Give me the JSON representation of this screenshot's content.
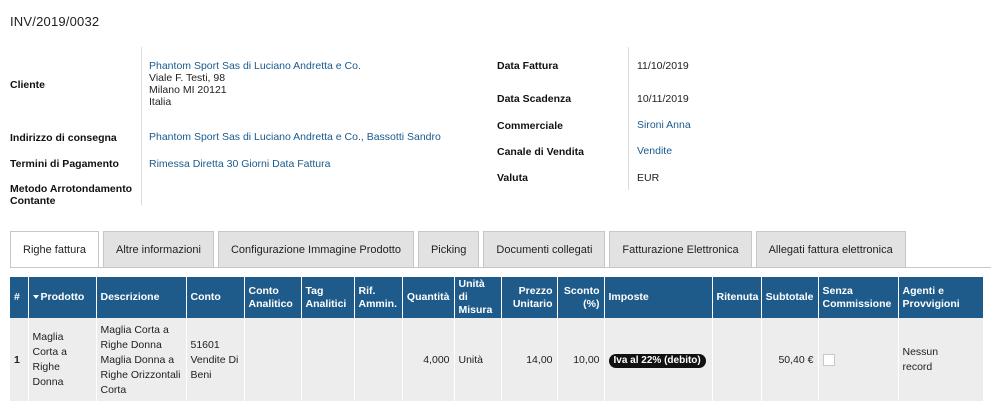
{
  "document": {
    "title": "INV/2019/0032"
  },
  "left_fields": {
    "cliente_label": "Cliente",
    "cliente_name": "Phantom Sport Sas di Luciano Andretta e Co.",
    "cliente_addr1": "Viale F. Testi, 98",
    "cliente_addr2": "Milano MI 20121",
    "cliente_addr3": "Italia",
    "consegna_label": "Indirizzo di consegna",
    "consegna_value": "Phantom Sport Sas di Luciano Andretta e Co., Bassotti Sandro",
    "pagamento_label": "Termini di Pagamento",
    "pagamento_value": "Rimessa Diretta 30 Giorni Data Fattura",
    "arrotondamento_label_1": "Metodo Arrotondamento",
    "arrotondamento_label_2": "Contante"
  },
  "right_fields": {
    "data_fattura_label": "Data Fattura",
    "data_fattura_value": "11/10/2019",
    "data_scadenza_label": "Data Scadenza",
    "data_scadenza_value": "10/11/2019",
    "commerciale_label": "Commerciale",
    "commerciale_value": "Sironi Anna",
    "canale_label": "Canale di Vendita",
    "canale_value": "Vendite",
    "valuta_label": "Valuta",
    "valuta_value": "EUR"
  },
  "tabs": [
    {
      "label": "Righe fattura",
      "active": true
    },
    {
      "label": "Altre informazioni"
    },
    {
      "label": "Configurazione Immagine Prodotto"
    },
    {
      "label": "Picking"
    },
    {
      "label": "Documenti collegati"
    },
    {
      "label": "Fatturazione Elettronica"
    },
    {
      "label": "Allegati fattura elettronica"
    }
  ],
  "table": {
    "headers": {
      "index": "#",
      "prodotto": "Prodotto",
      "descrizione": "Descrizione",
      "conto": "Conto",
      "conto_analitico_1": "Conto",
      "conto_analitico_2": "Analitico",
      "tag_1": "Tag",
      "tag_2": "Analitici",
      "rif_1": "Rif.",
      "rif_2": "Ammin.",
      "quantita": "Quantità",
      "unita_1": "Unità di",
      "unita_2": "Misura",
      "prezzo_1": "Prezzo",
      "prezzo_2": "Unitario",
      "sconto_1": "Sconto",
      "sconto_2": "(%)",
      "imposte": "Imposte",
      "ritenuta": "Ritenuta",
      "subtotale": "Subtotale",
      "senza_1": "Senza",
      "senza_2": "Commissione",
      "agenti_1": "Agenti e",
      "agenti_2": "Provvigioni"
    },
    "rows": [
      {
        "index": "1",
        "prodotto": [
          "Maglia",
          "Corta a",
          "Righe",
          "Donna"
        ],
        "descrizione": [
          "Maglia Corta a",
          "Righe Donna",
          "Maglia Donna a",
          "Righe Orizzontali",
          "Corta"
        ],
        "conto": [
          "51601",
          "Vendite Di",
          "Beni"
        ],
        "quantita": "4,000",
        "unita": "Unità",
        "prezzo": "14,00",
        "sconto": "10,00",
        "imposte": "Iva al 22% (debito)",
        "subtotale": "50,40 €",
        "agenti": [
          "Nessun",
          "record"
        ]
      }
    ]
  },
  "colors": {
    "header_bg": "#1f5b8a",
    "link": "#1a5a8e",
    "row_bg": "#ededed"
  }
}
